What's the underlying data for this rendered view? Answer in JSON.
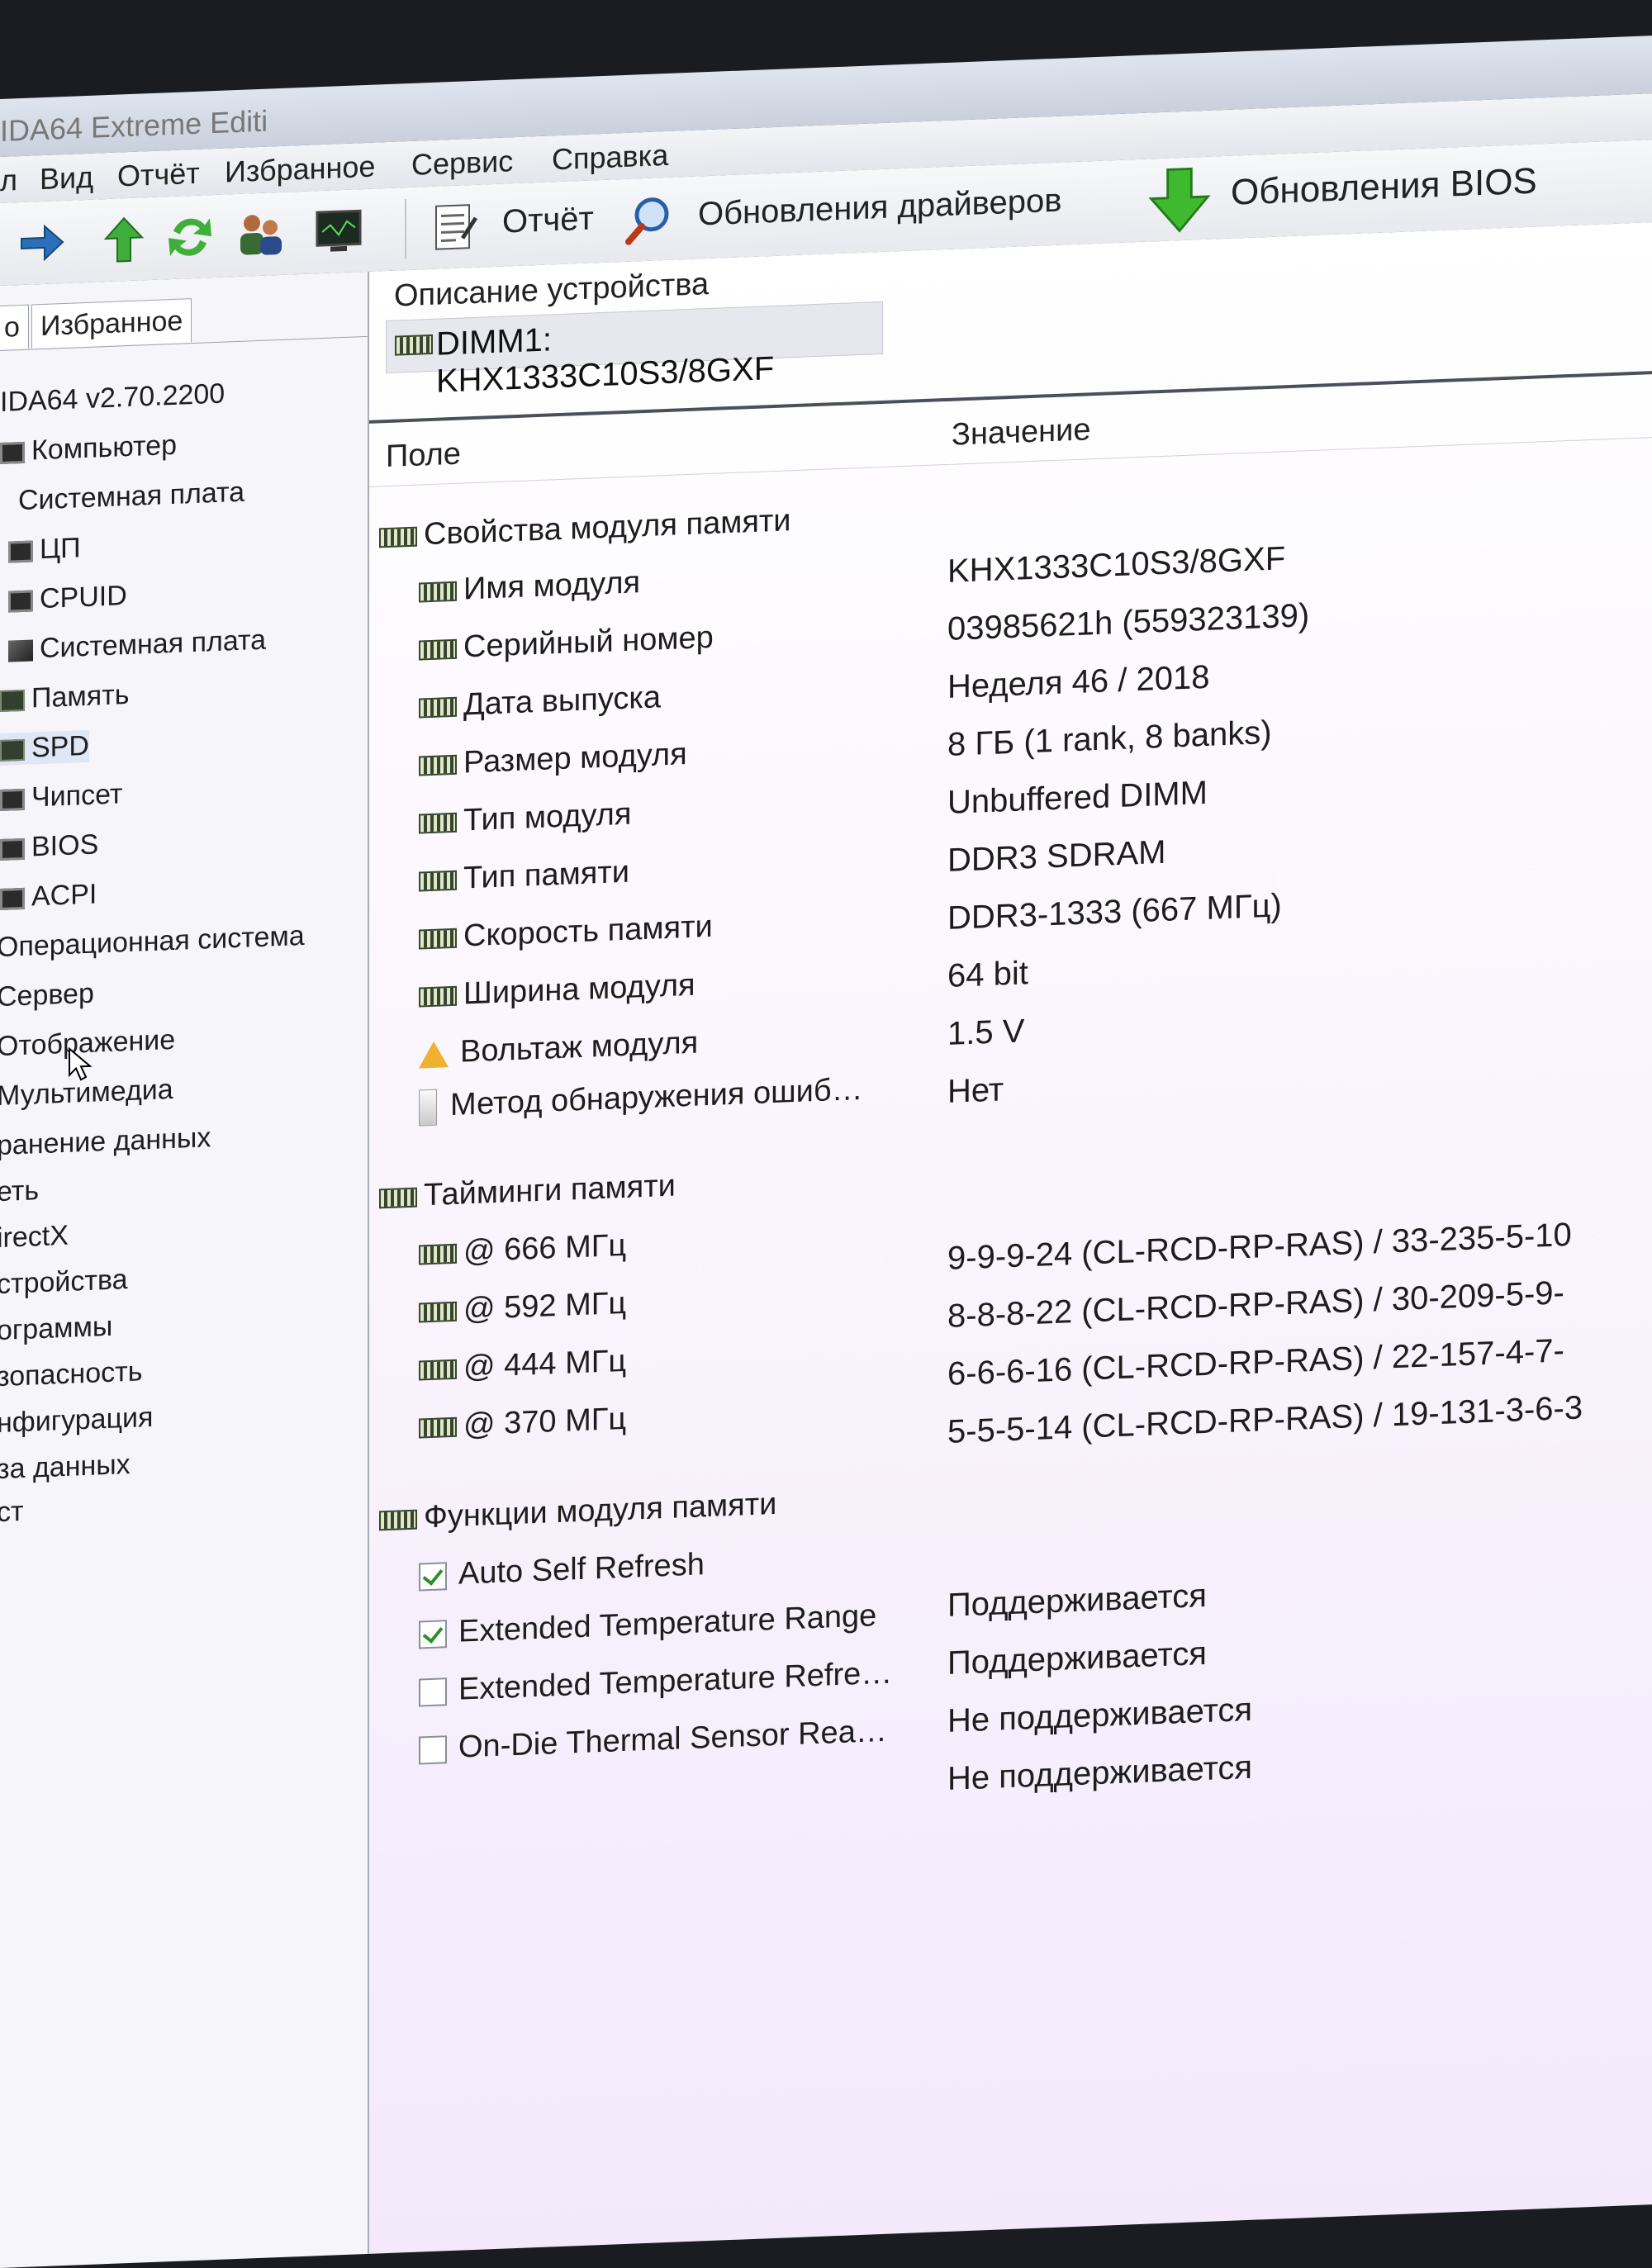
{
  "app": {
    "title_fragment": "IDA64 Extreme Editi"
  },
  "menu": [
    "л",
    "Вид",
    "Отчёт",
    "Избранное",
    "Сервис",
    "Справка"
  ],
  "toolbar": {
    "report_label": "Отчёт",
    "driver_updates_label": "Обновления драйверов",
    "bios_updates_label": "Обновления BIOS"
  },
  "left_panel": {
    "tabs": [
      "о",
      "Избранное"
    ],
    "tree": [
      "IDA64 v2.70.2200",
      "Компьютер",
      "Системная плата",
      "ЦП",
      "CPUID",
      "Системная плата",
      "Память",
      "SPD",
      "Чипсет",
      "BIOS",
      "ACPI",
      "Операционная система",
      "Сервер",
      "Отображение",
      "Мультимедиа",
      "ранение данных",
      "еть",
      "irectX",
      "стройства",
      "ограммы",
      "зопасность",
      "нфигурация",
      "за данных",
      "ст"
    ]
  },
  "main": {
    "description_header": "Описание устройства",
    "device": "DIMM1: KHX1333C10S3/8GXF",
    "columns": {
      "field": "Поле",
      "value": "Значение"
    },
    "module_section": "Свойства модуля памяти",
    "module_rows": [
      {
        "label": "Имя модуля",
        "value": "KHX1333C10S3/8GXF"
      },
      {
        "label": "Серийный номер",
        "value": "03985621h (559323139)"
      },
      {
        "label": "Дата выпуска",
        "value": "Неделя 46 / 2018"
      },
      {
        "label": "Размер модуля",
        "value": "8 ГБ (1 rank, 8 banks)"
      },
      {
        "label": "Тип модуля",
        "value": "Unbuffered DIMM"
      },
      {
        "label": "Тип памяти",
        "value": "DDR3 SDRAM"
      },
      {
        "label": "Скорость памяти",
        "value": "DDR3-1333 (667 МГц)"
      },
      {
        "label": "Ширина модуля",
        "value": "64 bit"
      },
      {
        "label": "Вольтаж модуля",
        "value": "1.5 V"
      },
      {
        "label": "Метод обнаружения ошиб…",
        "value": "Нет"
      }
    ],
    "timings_section": "Тайминги памяти",
    "timing_rows": [
      {
        "label": "@ 666 МГц",
        "value": "9-9-9-24  (CL-RCD-RP-RAS) / 33-235-5-10"
      },
      {
        "label": "@ 592 МГц",
        "value": "8-8-8-22  (CL-RCD-RP-RAS) / 30-209-5-9-"
      },
      {
        "label": "@ 444 МГц",
        "value": "6-6-6-16  (CL-RCD-RP-RAS) / 22-157-4-7-"
      },
      {
        "label": "@ 370 МГц",
        "value": "5-5-5-14  (CL-RCD-RP-RAS) / 19-131-3-6-3"
      }
    ],
    "features_section": "Функции модуля памяти",
    "feature_rows": [
      {
        "label": "Auto Self Refresh",
        "value": "Поддерживается",
        "checked": true
      },
      {
        "label": "Extended Temperature Range",
        "value": "Поддерживается",
        "checked": true
      },
      {
        "label": "Extended Temperature Refre…",
        "value": "Не поддерживается",
        "checked": false
      },
      {
        "label": "On-Die Thermal Sensor Rea…",
        "value": "Не поддерживается",
        "checked": false
      }
    ]
  }
}
